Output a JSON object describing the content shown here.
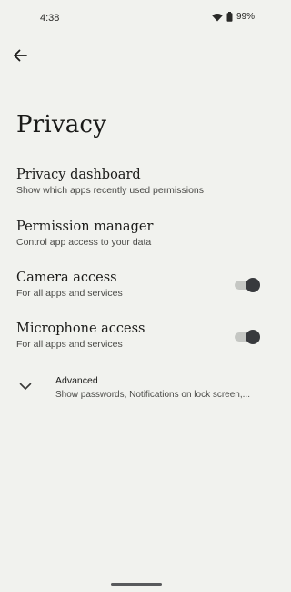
{
  "status_bar": {
    "time": "4:38",
    "battery": "99%"
  },
  "header": {
    "title": "Privacy"
  },
  "settings": [
    {
      "title": "Privacy dashboard",
      "subtitle": "Show which apps recently used permissions"
    },
    {
      "title": "Permission manager",
      "subtitle": "Control app access to your data"
    },
    {
      "title": "Camera access",
      "subtitle": "For all apps and services",
      "toggle": true
    },
    {
      "title": "Microphone access",
      "subtitle": "For all apps and services",
      "toggle": true
    }
  ],
  "advanced": {
    "title": "Advanced",
    "subtitle": "Show passwords, Notifications on lock screen,..."
  },
  "colors": {
    "background": "#f1f2ee",
    "toggle_thumb": "#383a3d",
    "toggle_track": "#c5c7c3"
  },
  "icons": [
    "wifi-icon",
    "battery-icon",
    "back-arrow-icon",
    "chevron-down-icon"
  ]
}
